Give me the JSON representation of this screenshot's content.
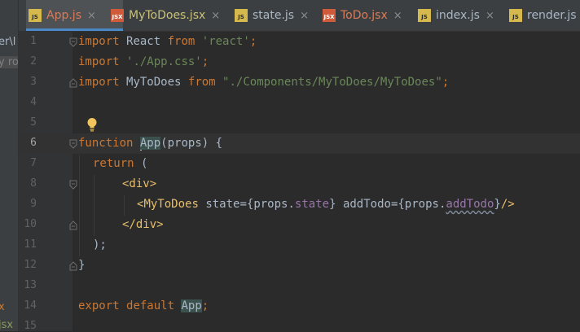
{
  "project_panel": {
    "fragments": [
      "er\\l",
      "y ro",
      "x",
      "jsx"
    ]
  },
  "tabs": [
    {
      "label": "App.js",
      "icon": "JS",
      "active": true,
      "closable": true
    },
    {
      "label": "MyToDoes.jsx",
      "icon": "JSX",
      "active": false,
      "closable": true
    },
    {
      "label": "state.js",
      "icon": "JS",
      "active": false,
      "closable": true
    },
    {
      "label": "ToDo.jsx",
      "icon": "JSX",
      "active": false,
      "closable": true
    },
    {
      "label": "index.js",
      "icon": "JS",
      "active": false,
      "closable": true
    },
    {
      "label": "render.js",
      "icon": "JS",
      "active": false,
      "closable": false
    }
  ],
  "tab_close_glyph": "×",
  "line_numbers": [
    "1",
    "2",
    "3",
    "4",
    "5",
    "6",
    "7",
    "8",
    "9",
    "10",
    "11",
    "12",
    "13",
    "14",
    "15"
  ],
  "current_line": "6",
  "code": {
    "l1": {
      "kw1": "import",
      "name": "React",
      "kw2": "from",
      "str": "'react'",
      "end": ";"
    },
    "l2": {
      "kw1": "import",
      "str": "'./App.css'",
      "end": ";"
    },
    "l3": {
      "kw1": "import",
      "name": "MyToDoes",
      "kw2": "from",
      "str": "\"./Components/MyToDoes/MyToDoes\"",
      "end": ";"
    },
    "l6": {
      "kw": "function",
      "name": "App",
      "rest": "(props) {"
    },
    "l7": {
      "kw": "return",
      "rest": "("
    },
    "l8": {
      "tag": "<div>"
    },
    "l9": {
      "open": "<",
      "tag": "MyToDoes",
      "attr1": "state",
      "eq1": "={props.",
      "prop1": "state",
      "close1": "}",
      "attr2": "addTodo",
      "eq2": "={props.",
      "prop2": "addTodo",
      "close2": "}",
      "end": "/>"
    },
    "l10": {
      "tag": "</div>"
    },
    "l11": {
      "text": ");"
    },
    "l12": {
      "text": "}"
    },
    "l14": {
      "kw1": "export",
      "kw2": "default",
      "name": "App",
      "end": ";"
    }
  },
  "colors": {
    "keyword": "#cc7832",
    "string": "#6a8759",
    "tag": "#e8bf6a",
    "property": "#9876aa",
    "text": "#a9b7c6",
    "active_tab_underline": "#4a88c7"
  },
  "icons": [
    "intention-bulb-icon",
    "fold-icon",
    "js-file-icon",
    "jsx-file-icon",
    "close-icon"
  ]
}
